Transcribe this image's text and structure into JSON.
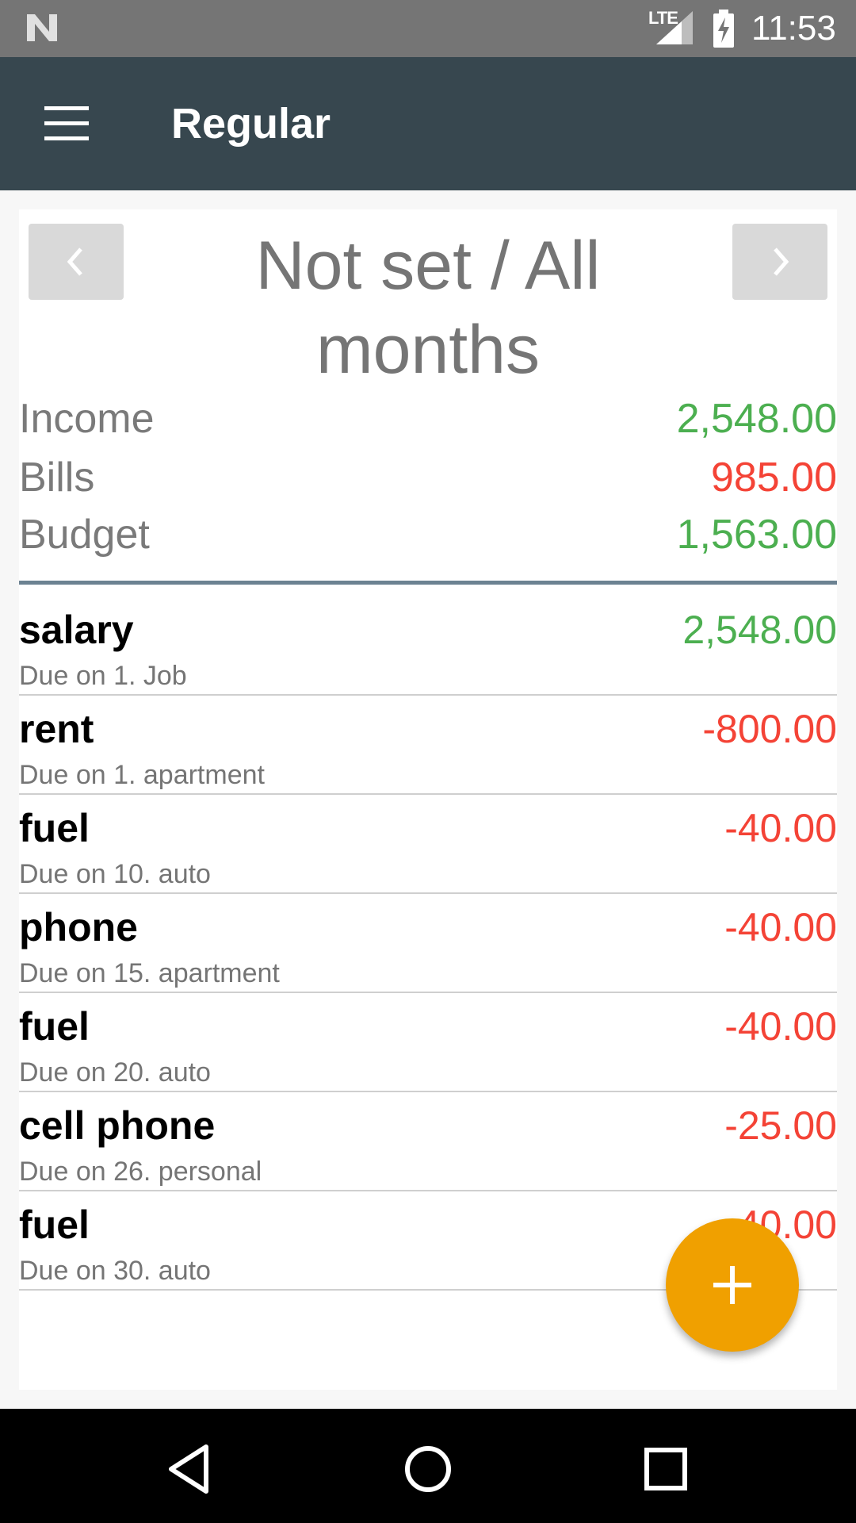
{
  "status_bar": {
    "time": "11:53",
    "network": "LTE",
    "icons": [
      "n-logo-icon",
      "signal-icon",
      "battery-charging-icon"
    ]
  },
  "app_bar": {
    "title": "Regular",
    "menu_icon": "menu-icon"
  },
  "period": {
    "label": "Not set / All months",
    "prev_icon": "chevron-left-icon",
    "next_icon": "chevron-right-icon"
  },
  "summary": [
    {
      "label": "Income",
      "value": "2,548.00",
      "color": "#4caf50"
    },
    {
      "label": "Bills",
      "value": "985.00",
      "color": "#f44336"
    },
    {
      "label": "Budget",
      "value": "1,563.00",
      "color": "#4caf50"
    }
  ],
  "entries": [
    {
      "name": "salary",
      "subtitle": "Due on 1. Job",
      "amount": "2,548.00",
      "type": "income"
    },
    {
      "name": "rent",
      "subtitle": "Due on 1. apartment",
      "amount": "-800.00",
      "type": "bill"
    },
    {
      "name": "fuel",
      "subtitle": "Due on 10. auto",
      "amount": "-40.00",
      "type": "bill"
    },
    {
      "name": "phone",
      "subtitle": "Due on 15. apartment",
      "amount": "-40.00",
      "type": "bill"
    },
    {
      "name": "fuel",
      "subtitle": "Due on 20. auto",
      "amount": "-40.00",
      "type": "bill"
    },
    {
      "name": "cell phone",
      "subtitle": "Due on 26. personal",
      "amount": "-25.00",
      "type": "bill"
    },
    {
      "name": "fuel",
      "subtitle": "Due on 30. auto",
      "amount": "-40.00",
      "type": "bill"
    }
  ],
  "fab": {
    "icon": "plus-icon"
  },
  "colors": {
    "app_bar": "#37474f",
    "status_bar": "#757575",
    "income": "#4caf50",
    "bill": "#f44336",
    "fab": "#f0a000"
  },
  "system_nav": {
    "icons": [
      "back-icon",
      "home-icon",
      "recents-icon"
    ]
  }
}
